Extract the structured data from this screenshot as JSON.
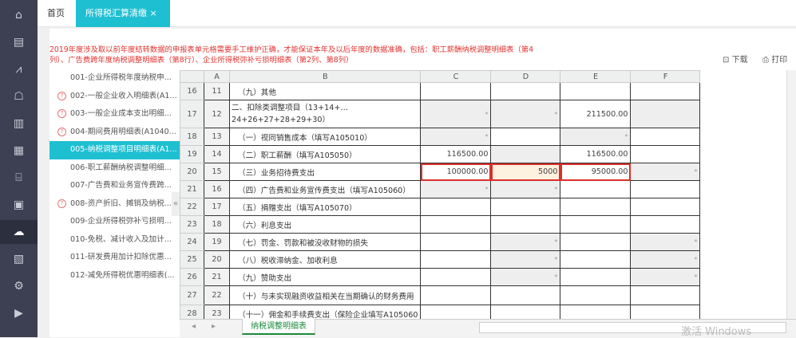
{
  "sidebar": {
    "icons": [
      "home-icon",
      "report-icon",
      "chart-icon",
      "tax-icon",
      "building-icon",
      "calculator-icon",
      "store-icon",
      "invoice-icon",
      "cloud-icon",
      "document-icon",
      "settings-icon",
      "media-icon"
    ],
    "active_index": 8
  },
  "tabs": {
    "home": "首页",
    "active": "所得税汇算清缴",
    "close": "×"
  },
  "notice": "2019年度涉及取以前年度结转数据的申报表单元格需要手工维护正确，才能保证本年及以后年度的数据准确，包括：职工薪酬纳税调整明细表（第4列）、广告费跨年度纳税调整明细表（第8行）、企业所得税弥补亏损明细表（第2列、第8列）",
  "toolbar": {
    "download": "下载",
    "print": "打印"
  },
  "forms": [
    {
      "label": "001-企业所得税年度纳税申...",
      "warn": false
    },
    {
      "label": "002-一般企业收入明细表(A1...",
      "warn": true
    },
    {
      "label": "003-一般企业成本支出明细...",
      "warn": true
    },
    {
      "label": "004-期间费用明细表(A1040...",
      "warn": true
    },
    {
      "label": "005-纳税调整项目明细表(A1...",
      "warn": false,
      "active": true
    },
    {
      "label": "006-职工薪酬纳税调整明细...",
      "warn": false
    },
    {
      "label": "007-广告费和业务宣传费跨...",
      "warn": false
    },
    {
      "label": "008-资产折旧、摊销及纳税...",
      "warn": true
    },
    {
      "label": "009-企业所得税弥补亏损明...",
      "warn": false
    },
    {
      "label": "010-免税、减计收入及加计...",
      "warn": false
    },
    {
      "label": "011-研发费用加计扣除优惠...",
      "warn": false
    },
    {
      "label": "012-减免所得税优惠明细表(...",
      "warn": false
    }
  ],
  "grid": {
    "columns": [
      "A",
      "B",
      "C",
      "D",
      "E",
      "F"
    ],
    "rows": [
      {
        "r": "16",
        "a": "11",
        "b": "（九）其他",
        "c": "",
        "d": "",
        "e": "",
        "f": ""
      },
      {
        "r": "17",
        "a": "12",
        "b": "二、扣除类调整项目（13+14+…24+26+27+28+29+30）",
        "c": "*",
        "d": "*",
        "e": "211500.00",
        "f": ""
      },
      {
        "r": "18",
        "a": "13",
        "b": "（一）视同销售成本（填写A105010）",
        "c": "*",
        "d": "",
        "e": "*",
        "f": ""
      },
      {
        "r": "19",
        "a": "14",
        "b": "（二）职工薪酬（填写A105050）",
        "c": "116500.00",
        "d": "",
        "e": "116500.00",
        "f": ""
      },
      {
        "r": "20",
        "a": "15",
        "b": "（三）业务招待费支出",
        "c": "100000.00",
        "d": "5000",
        "e": "95000.00",
        "f": "*"
      },
      {
        "r": "21",
        "a": "16",
        "b": "（四）广告费和业务宣传费支出（填写A105060）",
        "c": "*",
        "d": "*",
        "e": "",
        "f": ""
      },
      {
        "r": "22",
        "a": "17",
        "b": "（五）捐赠支出（填写A105070）",
        "c": "",
        "d": "",
        "e": "",
        "f": ""
      },
      {
        "r": "23",
        "a": "18",
        "b": "（六）利息支出",
        "c": "",
        "d": "",
        "e": "",
        "f": ""
      },
      {
        "r": "24",
        "a": "19",
        "b": "（七）罚金、罚款和被没收财物的损失",
        "c": "",
        "d": "*",
        "e": "",
        "f": "*"
      },
      {
        "r": "25",
        "a": "20",
        "b": "（八）税收滞纳金、加收利息",
        "c": "",
        "d": "*",
        "e": "",
        "f": "*"
      },
      {
        "r": "26",
        "a": "21",
        "b": "（九）赞助支出",
        "c": "",
        "d": "*",
        "e": "",
        "f": "*"
      },
      {
        "r": "27",
        "a": "22",
        "b": "（十）与未实现融资收益相关在当期确认的财务费用",
        "c": "",
        "d": "",
        "e": "",
        "f": ""
      },
      {
        "r": "28",
        "a": "23",
        "b": "（十一）佣金和手续费支出（保险企业填写A105060",
        "c": "",
        "d": "",
        "e": "",
        "f": ""
      }
    ]
  },
  "sheet_tab": "纳税调整明细表",
  "watermark": "激活 Windows"
}
